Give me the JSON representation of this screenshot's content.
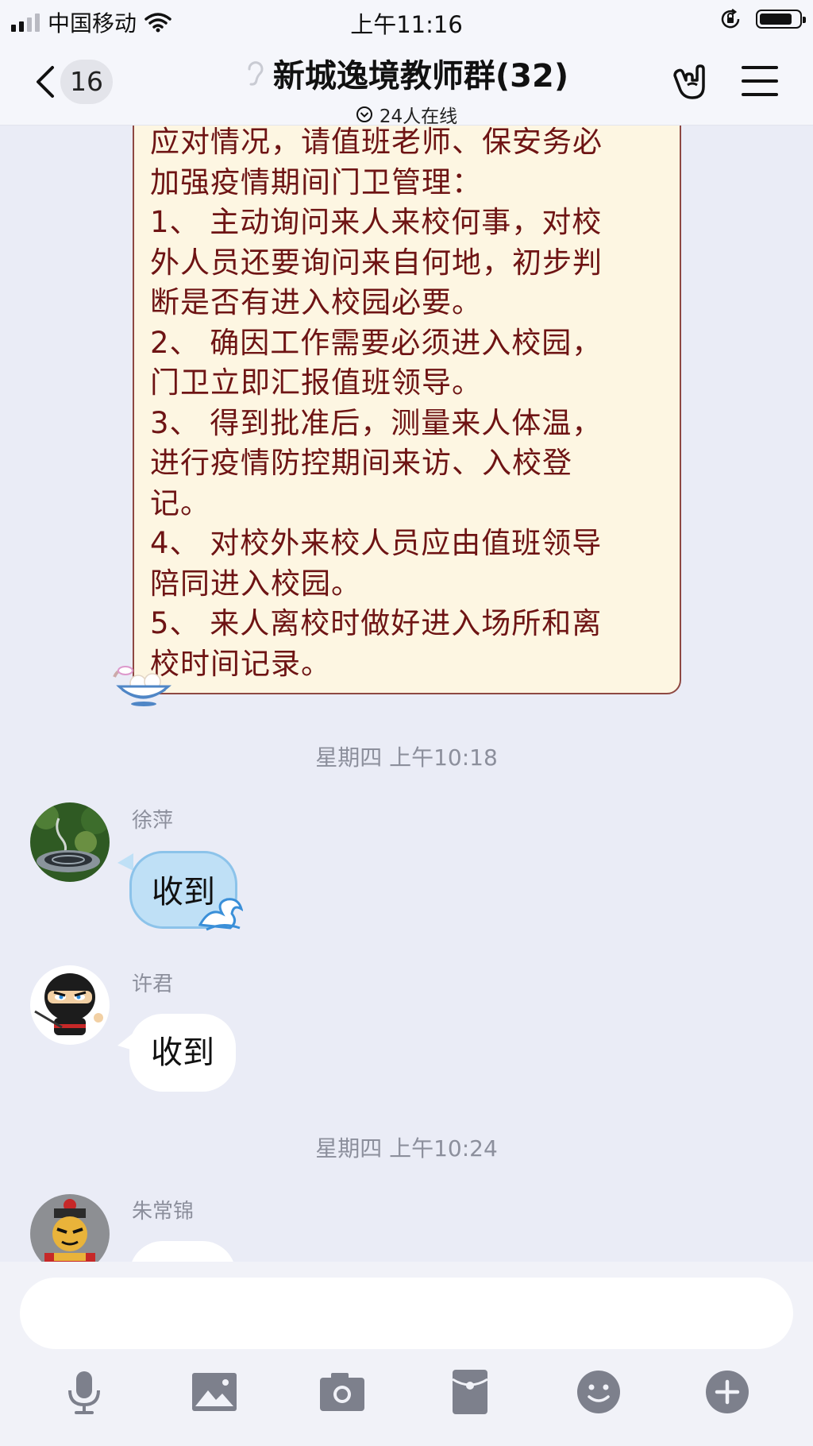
{
  "status_bar": {
    "carrier": "中国移动",
    "time": "上午11:16"
  },
  "header": {
    "unread_count": "16",
    "group_title": "新城逸境教师群(32)",
    "online_text": "24人在线"
  },
  "notice_message": {
    "lines": [
      "应对情况，请值班老师、保安务必",
      "加强疫情期间门卫管理：",
      "1、 主动询问来人来校何事，对校",
      "外人员还要询问来自何地，初步判",
      "断是否有进入校园必要。",
      "2、 确因工作需要必须进入校园，",
      "门卫立即汇报值班领导。",
      "3、 得到批准后，测量来人体温，",
      "进行疫情防控期间来访、入校登",
      "记。",
      "4、 对校外来校人员应由值班领导",
      "陪同进入校园。",
      "5、 来人离校时做好进入场所和离",
      "校时间记录。"
    ]
  },
  "timestamps": [
    "星期四 上午10:18",
    "星期四 上午10:24"
  ],
  "messages": [
    {
      "sender": "徐萍",
      "text": "收到"
    },
    {
      "sender": "许君",
      "text": "收到"
    },
    {
      "sender": "朱常锦",
      "text": ""
    }
  ],
  "input": {
    "placeholder": ""
  },
  "colors": {
    "chat_background": "#eaecf6",
    "notice_bubble_bg": "#fdf6e2",
    "notice_text": "#6e1414",
    "blue_bubble": "#bfe0f6"
  }
}
